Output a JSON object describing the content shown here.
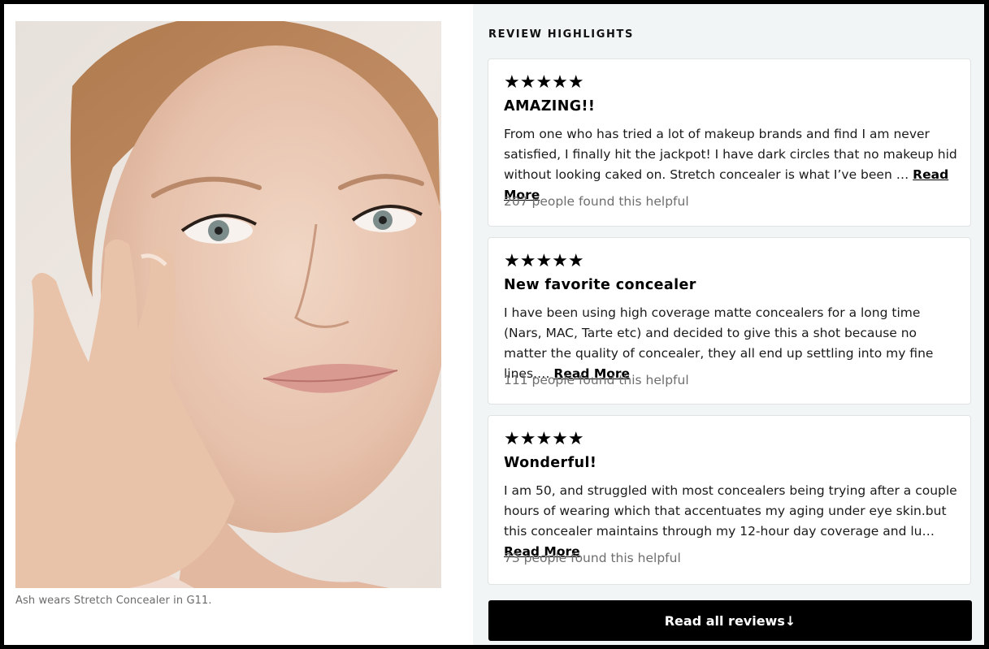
{
  "image": {
    "caption": "Ash wears Stretch Concealer in G11."
  },
  "reviews_section": {
    "heading": "REVIEW HIGHLIGHTS",
    "reviews": [
      {
        "stars": "★★★★★",
        "rating": 5,
        "title": "AMAZING!!",
        "body": "From one who has tried a lot of makeup brands and find I am never satisfied, I finally hit the jackpot! I have dark circles that no makeup hid without looking caked on. Stretch concealer is what I’ve been …",
        "read_more": "Read More",
        "helpful": "207 people found this helpful"
      },
      {
        "stars": "★★★★★",
        "rating": 5,
        "title": "New favorite concealer",
        "body": "I have been using high coverage matte concealers for a long time (Nars, MAC, Tarte etc) and decided to give this a shot because no matter the quality of concealer, they all end up settling into my fine lines.…",
        "read_more": "Read More",
        "helpful": "111 people found this helpful"
      },
      {
        "stars": "★★★★★",
        "rating": 5,
        "title": "Wonderful!",
        "body": "I am 50, and struggled with most concealers being trying after a couple hours of wearing which that accentuates my aging under eye skin.but this concealer maintains through my 12-hour day coverage and lu…",
        "read_more": "Read More",
        "helpful": "73 people found this helpful"
      }
    ],
    "cta_label": "Read all reviews↓"
  },
  "colors": {
    "panel_bg": "#f2f5f5",
    "cta_bg": "#000000",
    "muted_text": "#6e6e6e"
  }
}
